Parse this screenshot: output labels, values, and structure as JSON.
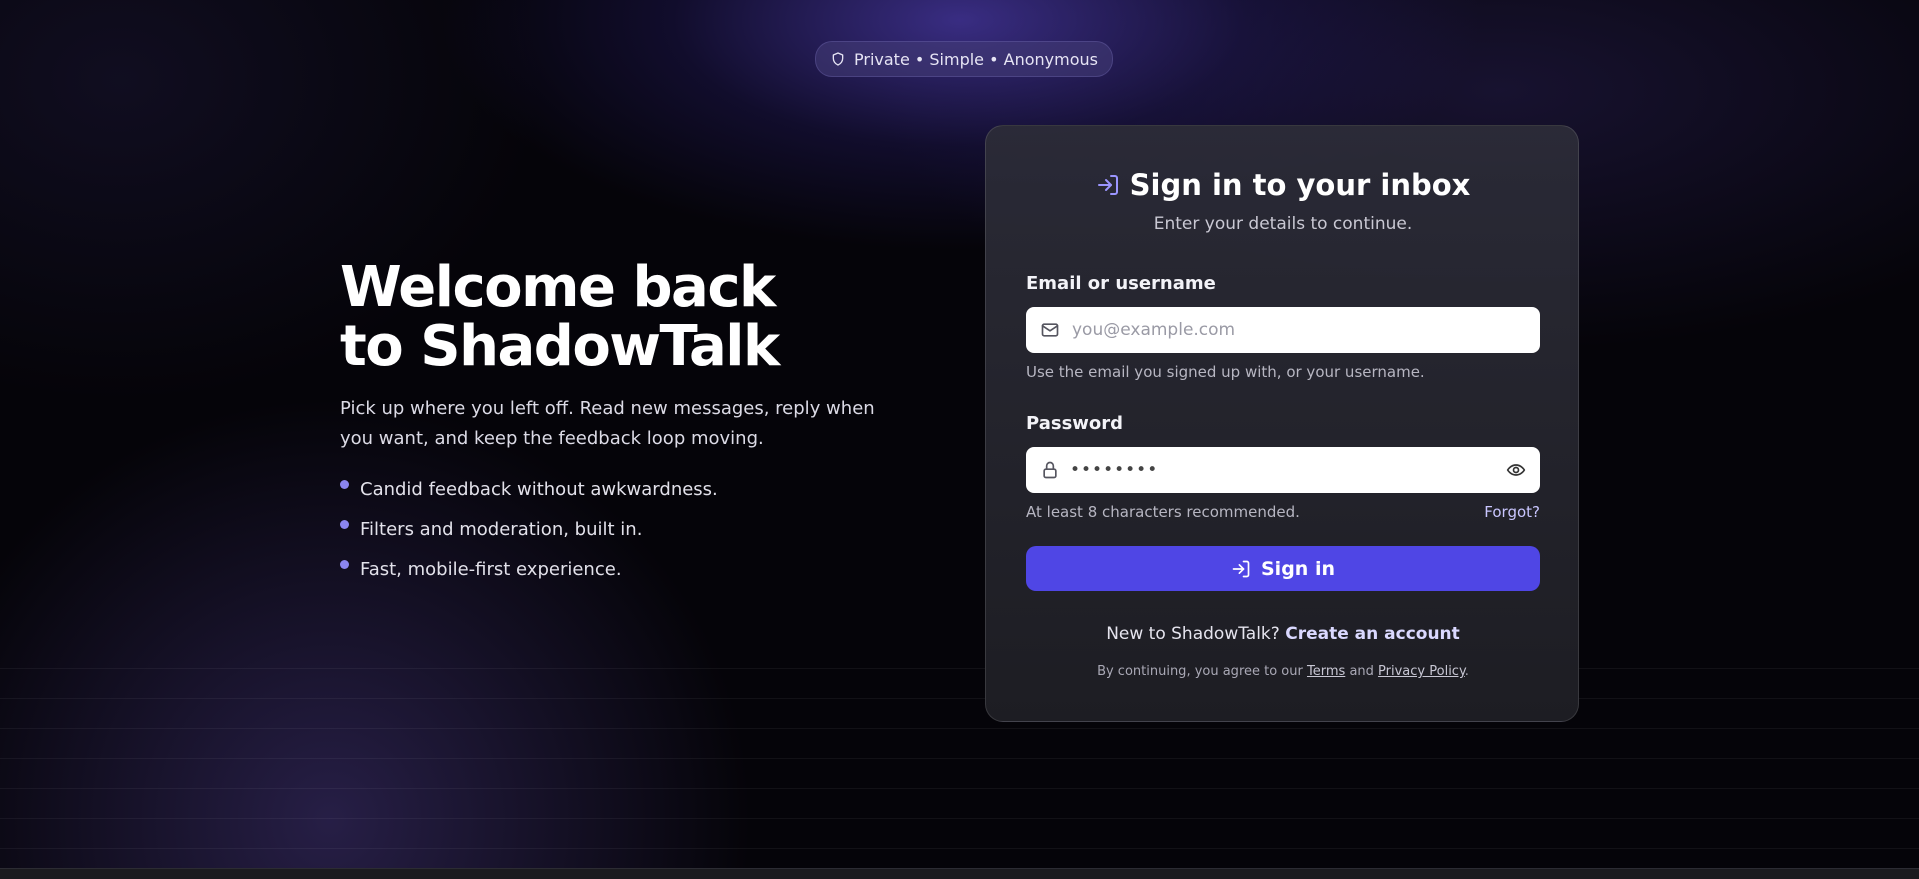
{
  "badge": {
    "text": "Private • Simple • Anonymous",
    "icon": "shield-icon"
  },
  "hero": {
    "title_line1": "Welcome back",
    "title_line2": "to ShadowTalk",
    "subtitle": "Pick up where you left off. Read new messages, reply when you want, and keep the feedback loop moving.",
    "features": [
      "Candid feedback without awkwardness.",
      "Filters and moderation, built in.",
      "Fast, mobile-first experience."
    ]
  },
  "card": {
    "title": "Sign in to your inbox",
    "subtitle": "Enter your details to continue.",
    "email": {
      "label": "Email or username",
      "placeholder": "you@example.com",
      "hint": "Use the email you signed up with, or your username."
    },
    "password": {
      "label": "Password",
      "value_masked": "••••••••",
      "hint": "At least 8 characters recommended.",
      "forgot_label": "Forgot?"
    },
    "submit_label": "Sign in",
    "signup_prompt": "New to ShadowTalk?",
    "signup_link": "Create an account",
    "legal_prefix": "By continuing, you agree to our",
    "terms_link": "Terms",
    "legal_and": "and",
    "privacy_link": "Privacy Policy",
    "legal_suffix": "."
  },
  "colors": {
    "accent": "#4f46e5",
    "bullet": "#8b85f0",
    "background": "#050409"
  }
}
